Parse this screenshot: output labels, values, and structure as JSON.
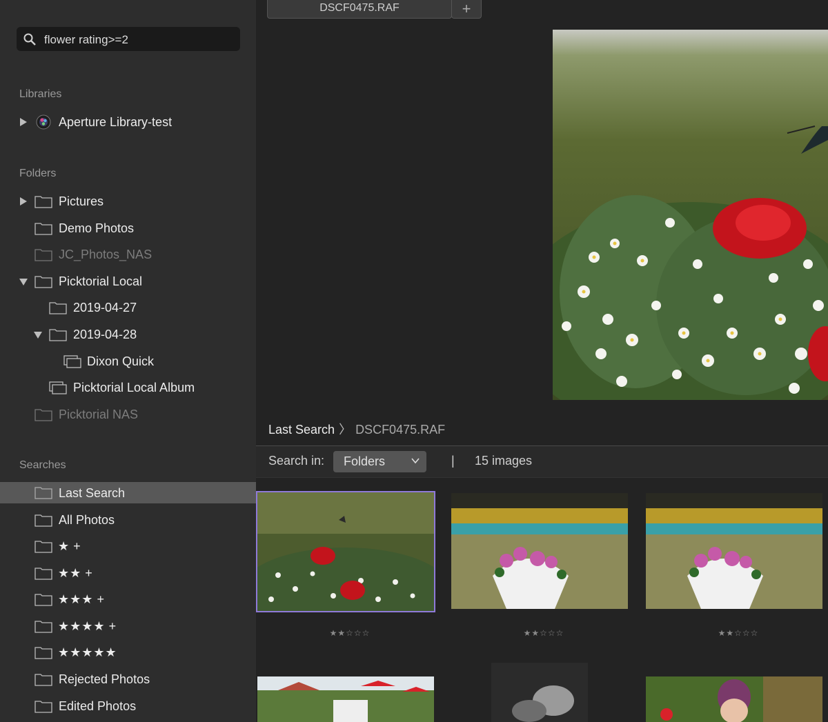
{
  "search": {
    "query": "flower rating>=2"
  },
  "sections": {
    "libraries": "Libraries",
    "folders": "Folders",
    "searches": "Searches"
  },
  "libraries": [
    {
      "label": "Aperture Library-test"
    }
  ],
  "folders": [
    {
      "label": "Pictures"
    },
    {
      "label": "Demo Photos"
    },
    {
      "label": "JC_Photos_NAS"
    },
    {
      "label": "Picktorial Local"
    },
    {
      "label": "2019-04-27"
    },
    {
      "label": "2019-04-28"
    },
    {
      "label": "Dixon Quick"
    },
    {
      "label": "Picktorial Local Album"
    },
    {
      "label": "Picktorial NAS"
    }
  ],
  "searches": [
    {
      "label": "Last Search"
    },
    {
      "label": "All Photos"
    },
    {
      "stars": "★",
      "suffix": "+"
    },
    {
      "stars": "★★",
      "suffix": "+"
    },
    {
      "stars": "★★★",
      "suffix": "+"
    },
    {
      "stars": "★★★★",
      "suffix": "+"
    },
    {
      "stars": "★★★★★",
      "suffix": ""
    },
    {
      "label": "Rejected Photos"
    },
    {
      "label": "Edited Photos"
    }
  ],
  "tab": {
    "filename": "DSCF0475.RAF",
    "add_label": "+"
  },
  "breadcrumb": {
    "root": "Last Search",
    "separator": "〉",
    "current": "DSCF0475.RAF"
  },
  "toolbar": {
    "search_in_label": "Search in:",
    "scope": "Folders",
    "separator": "|",
    "count": "15 images"
  },
  "thumbnails": [
    {
      "rating": "★★☆☆☆"
    },
    {
      "rating": "★★☆☆☆"
    },
    {
      "rating": "★★☆☆☆"
    }
  ],
  "colors": {
    "accent_selection": "#8f7ad9",
    "sidebar_bg": "#2d2d2d",
    "main_bg": "#232323",
    "selected_row": "#585858"
  }
}
